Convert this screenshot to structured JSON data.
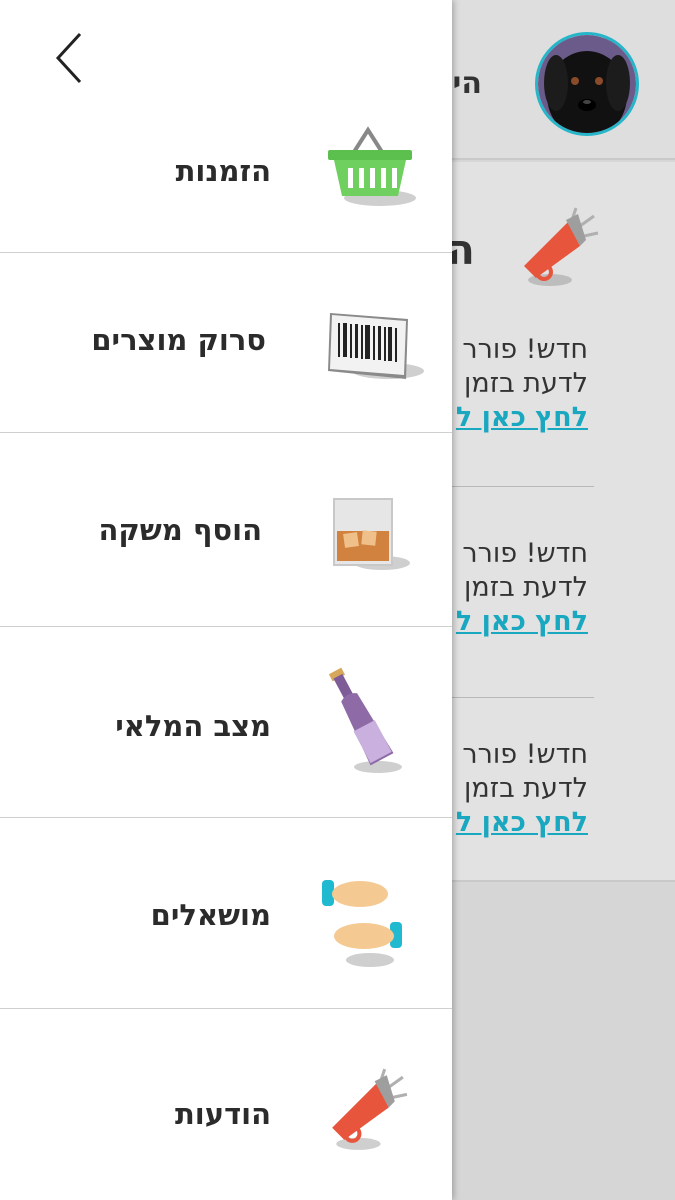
{
  "background": {
    "greeting": "הי",
    "card_title": "ה",
    "news": [
      {
        "line1": "חדש! פורר",
        "line2": "לדעת בזמן",
        "link": "לחץ כאן ל"
      },
      {
        "line1": "חדש! פורר",
        "line2": "לדעת בזמן",
        "link": "לחץ כאן ל"
      },
      {
        "line1": "חדש! פורר",
        "line2": "לדעת בזמן",
        "link": "לחץ כאן ל"
      }
    ]
  },
  "drawer": {
    "back_icon": "chevron-left-icon",
    "items": [
      {
        "label": "הזמנות",
        "icon": "basket-icon"
      },
      {
        "label": "סרוק מוצרים",
        "icon": "barcode-icon"
      },
      {
        "label": "הוסף משקה",
        "icon": "whiskey-glass-icon"
      },
      {
        "label": "מצב המלאי",
        "icon": "bottle-icon"
      },
      {
        "label": "מושאלים",
        "icon": "hands-icon"
      },
      {
        "label": "הודעות",
        "icon": "megaphone-icon"
      }
    ]
  },
  "colors": {
    "accent": "#1aa7c0",
    "avatar_ring": "#26b5c9",
    "megaphone": "#e8553d",
    "basket": "#5cc04f",
    "bottle": "#8e6aa6"
  }
}
